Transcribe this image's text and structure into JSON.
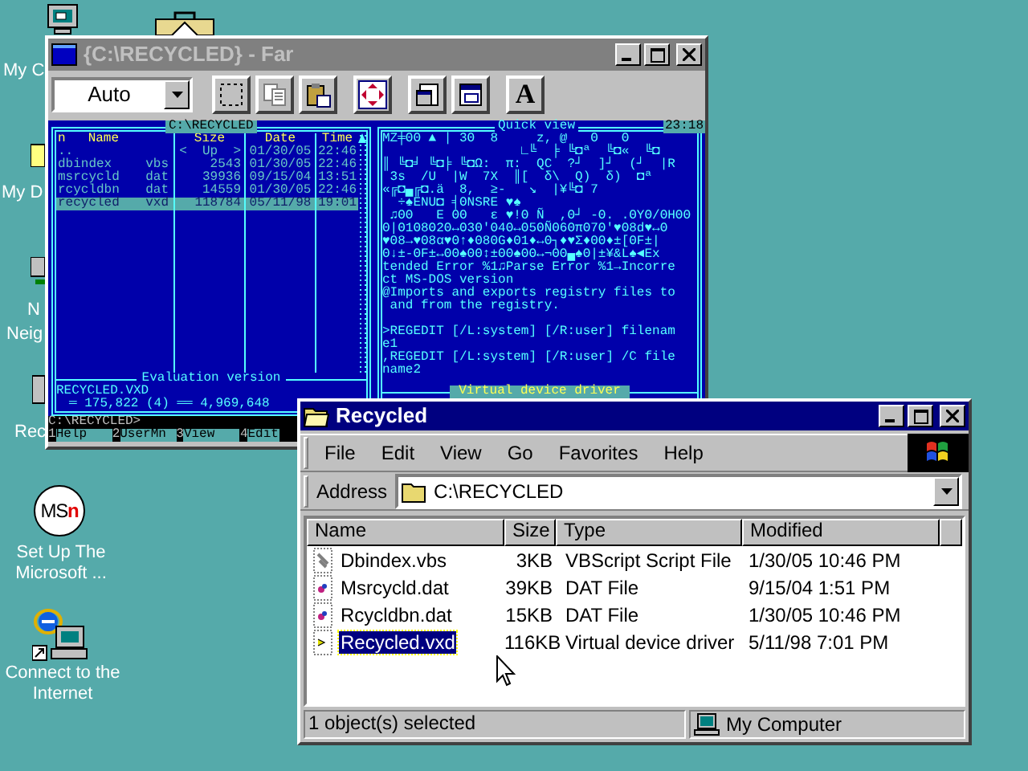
{
  "desktop": {
    "icons": [
      {
        "kind": "computer",
        "lines": [
          "My C"
        ]
      },
      {
        "kind": "briefcase"
      },
      {
        "kind": "documents",
        "lines": [
          "My D"
        ]
      },
      {
        "kind": "network",
        "lines": [
          "N",
          "Neig"
        ]
      },
      {
        "kind": "recycle",
        "lines": [
          "Rec"
        ]
      },
      {
        "kind": "msn",
        "logo": [
          "MS",
          "n"
        ],
        "label": "Set Up The Microsoft ..."
      },
      {
        "kind": "internet",
        "label": "Connect to the Internet"
      }
    ]
  },
  "far": {
    "title": "{C:\\RECYCLED} - Far",
    "active": false,
    "toolbar": {
      "mode": "Auto",
      "buttons": [
        {
          "kind": "select"
        },
        {
          "kind": "copy"
        },
        {
          "kind": "paste"
        },
        {
          "kind": "fullscreen"
        },
        {
          "kind": "properties"
        },
        {
          "kind": "window"
        },
        {
          "kind": "font",
          "label": "A"
        }
      ]
    },
    "left_panel": {
      "path": "C:\\RECYCLED",
      "headers": [
        "n",
        "Name",
        "Size",
        "Date",
        "Time"
      ],
      "rows": [
        {
          "name": "..",
          "size": "<  Up  >",
          "date": "01/30/05",
          "time": "22:46",
          "selected": false
        },
        {
          "name": "dbindex",
          "ext": "vbs",
          "size": "2543",
          "date": "01/30/05",
          "time": "22:46",
          "selected": false
        },
        {
          "name": "msrcycld",
          "ext": "dat",
          "size": "39936",
          "date": "09/15/04",
          "time": "13:51",
          "selected": false
        },
        {
          "name": "rcycldbn",
          "ext": "dat",
          "size": "14559",
          "date": "01/30/05",
          "time": "22:46",
          "selected": false
        },
        {
          "name": "recycled",
          "ext": "vxd",
          "size": "118784",
          "date": "05/11/98",
          "time": "19:01",
          "selected": true
        }
      ],
      "footer_title": "Evaluation version",
      "current_file": "RECYCLED.VXD",
      "totals": "═ 175,822 (4) ══ 4,969,648"
    },
    "quick_view": {
      "title": "Quick view",
      "clock": "23:18",
      "paragraphs": [
        [
          "MZ╪ΘΘ ▲ | 3Θ  8     z, @   Θ   Θ",
          "                  ∟╚  ╞ ╚◘ª  ╚◘«  ╚◘",
          "║ ╚◘╛ ╚◘╞ ╚◘Ω:  π:  QC  ?┘  ]┘  (┘  |R",
          " 3s  /U  |W  7X  ║[  δ\\  Q)  δ)  ◘ª",
          "«╔◘▄╔◘.ä  8,  ≥-   ↘  |¥╚◘ 7",
          "  ÷♠ENU◘ ╡ΘNSRE ♥♠",
          " ♫ΘΘ   Ε ΘΘ   ε ♥!Θ Ñ  ,Θ┘ -Θ. .ΘΥΘ/ΘΗΘΘ",
          "Θ|Θ1Θ8Θ2Θ↔Θ3Θ'Θ4Θ↔Θ5ΘÑΘ6ΘπΘ7Θ'♥Θ8d♥↔Θ",
          "♥Θ8→♥Θ8α♥Θ↑♦Θ8ΘG♦Θ1♦↔Θ┐♦♥Σ♦ΘΘ♦±[ΘF±|",
          "Θ↓±-ΘF±↔ΘΘ♠ΘΘ↕±ΘΘ♠ΘΘ↔¬ΘΘ▄♠Θ|±¥&L♠◄Ex",
          "tended Error %1♫Parse Error %1→Incorre",
          "ct MS-DOS version",
          "@Imports and exports registry files to",
          " and from the registry."
        ],
        [
          ">REGEDIT [/L:system] [/R:user] filenam",
          "e1",
          ",REGEDIT [/L:system] [/R:user] /C file",
          "name2"
        ]
      ],
      "status": "Virtual device driver"
    },
    "command_line": "C:\\RECYCLED>",
    "keybar": [
      {
        "num": "1",
        "label": "Help"
      },
      {
        "num": "2",
        "label": "UserMn"
      },
      {
        "num": "3",
        "label": "View"
      },
      {
        "num": "4",
        "label": "Edit"
      }
    ]
  },
  "explorer": {
    "title": "Recycled",
    "active": true,
    "menu": [
      "File",
      "Edit",
      "View",
      "Go",
      "Favorites",
      "Help"
    ],
    "address_label": "Address",
    "address": "C:\\RECYCLED",
    "columns": [
      "Name",
      "Size",
      "Type",
      "Modified"
    ],
    "files": [
      {
        "kind": "script",
        "name": "Dbindex.vbs",
        "size": "3KB",
        "type": "VBScript Script File",
        "modified": "1/30/05 10:46 PM",
        "selected": false
      },
      {
        "kind": "data",
        "name": "Msrcycld.dat",
        "size": "39KB",
        "type": "DAT File",
        "modified": "9/15/04 1:51 PM",
        "selected": false
      },
      {
        "kind": "data",
        "name": "Rcycldbn.dat",
        "size": "15KB",
        "type": "DAT File",
        "modified": "1/30/05 10:46 PM",
        "selected": false
      },
      {
        "kind": "driver",
        "name": "Recycled.vxd",
        "size": "116KB",
        "type": "Virtual device driver",
        "modified": "5/11/98 7:01 PM",
        "selected": true
      }
    ],
    "status": "1 object(s) selected",
    "zone": "My Computer"
  }
}
